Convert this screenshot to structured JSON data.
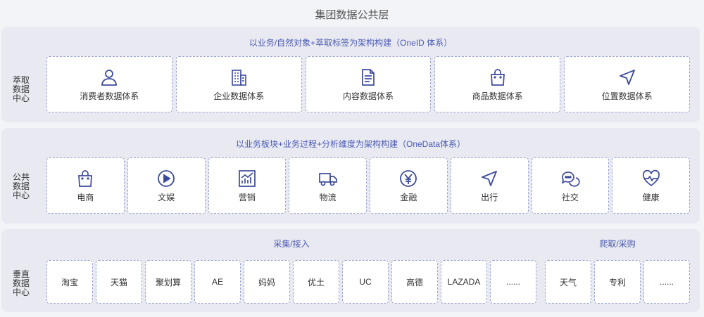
{
  "title": "集团数据公共层",
  "bands": {
    "extract": {
      "side_label": "萃取\n数据\n中心",
      "header": "以业务/自然对象+萃取标签为架构构建（OneID 体系）",
      "cards": [
        {
          "label": "消费者数据体系",
          "icon": "user-icon"
        },
        {
          "label": "企业数据体系",
          "icon": "building-icon"
        },
        {
          "label": "内容数据体系",
          "icon": "document-icon"
        },
        {
          "label": "商品数据体系",
          "icon": "shopping-bag-icon"
        },
        {
          "label": "位置数据体系",
          "icon": "navigation-arrow-icon"
        }
      ]
    },
    "public": {
      "side_label": "公共\n数据\n中心",
      "header": "以业务板块+业务过程+分析维度为架构构建（OneData体系）",
      "cards": [
        {
          "label": "电商",
          "icon": "shopping-bag-icon"
        },
        {
          "label": "文娱",
          "icon": "play-icon"
        },
        {
          "label": "营销",
          "icon": "chart-icon"
        },
        {
          "label": "物流",
          "icon": "truck-icon"
        },
        {
          "label": "金融",
          "icon": "yen-icon"
        },
        {
          "label": "出行",
          "icon": "navigation-arrow-icon"
        },
        {
          "label": "社交",
          "icon": "chat-icon"
        },
        {
          "label": "健康",
          "icon": "heart-pulse-icon"
        }
      ]
    },
    "vertical": {
      "side_label": "垂直\n数据\n中心",
      "collect_header": "采集/接入",
      "crawl_header": "爬取/采购",
      "collect_cards": [
        "淘宝",
        "天猫",
        "聚划算",
        "AE",
        "妈妈",
        "优土",
        "UC",
        "高德",
        "LAZADA",
        "......"
      ],
      "crawl_cards": [
        "天气",
        "专利",
        "......"
      ]
    }
  },
  "colors": {
    "accent": "#4a5ab5",
    "icon": "#3c4a9b",
    "band_bg": "#e9eaf1",
    "card_border": "#9aa3cf"
  }
}
